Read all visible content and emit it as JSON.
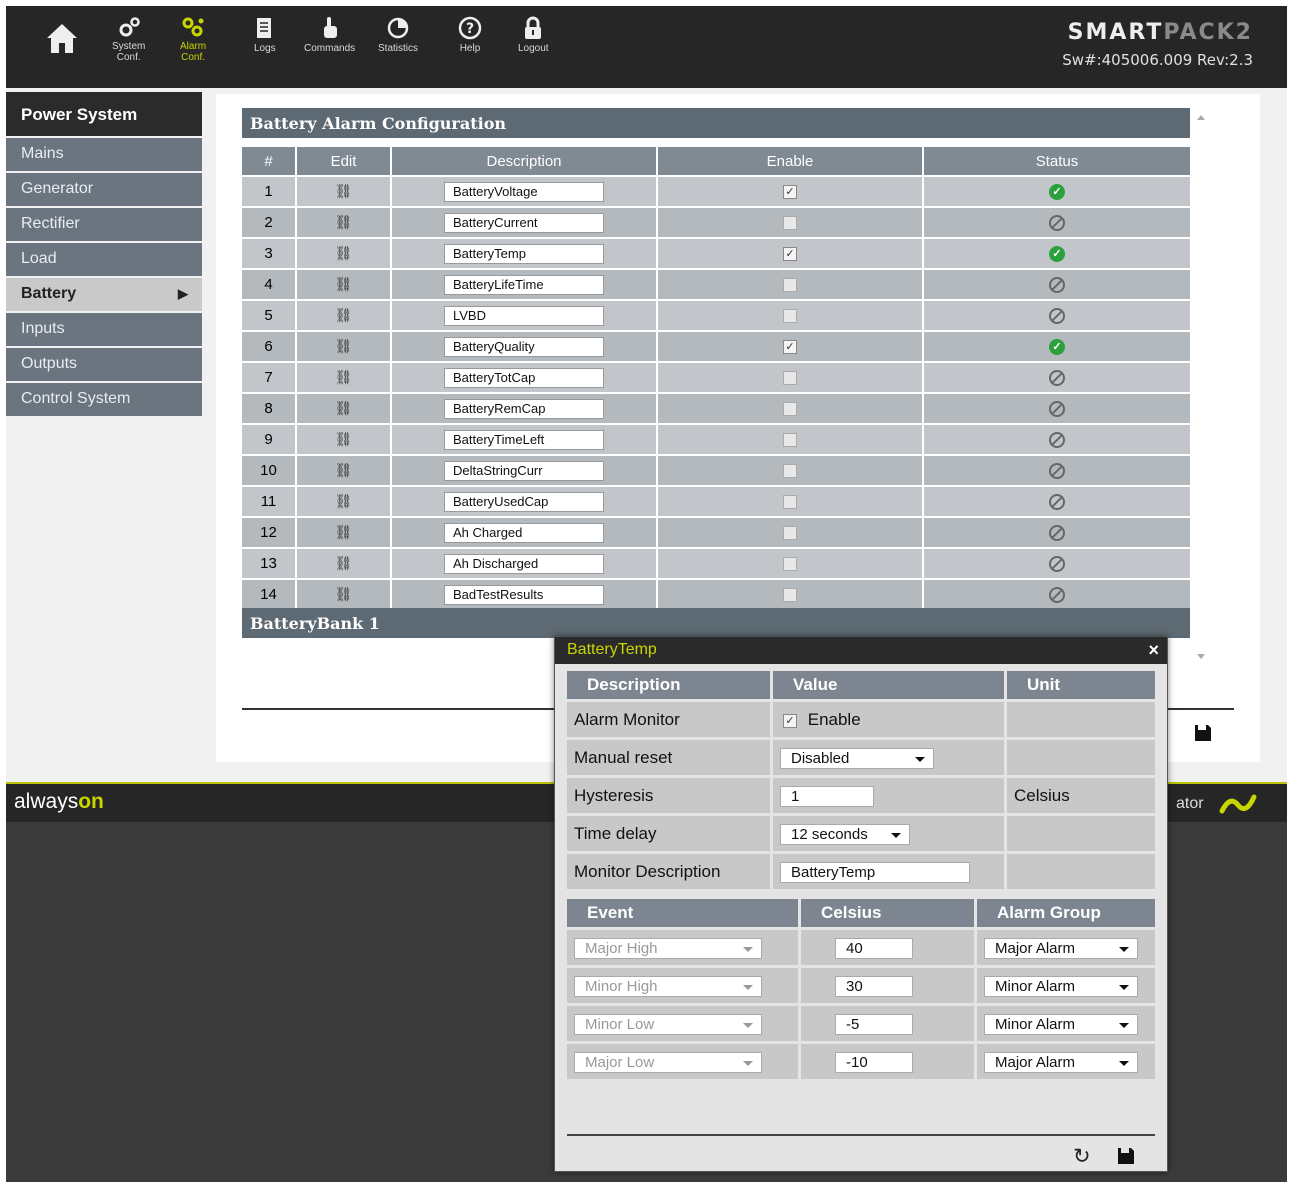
{
  "nav": [
    {
      "label": "",
      "icon": "home-icon"
    },
    {
      "label": "System\nConf.",
      "icon": "gears-icon"
    },
    {
      "label": "Alarm\nConf.",
      "icon": "alarm-gears-icon",
      "active": true
    },
    {
      "label": "Logs",
      "icon": "logs-icon"
    },
    {
      "label": "Commands",
      "icon": "hand-pointer-icon"
    },
    {
      "label": "Statistics",
      "icon": "pie-chart-icon"
    },
    {
      "label": "Help",
      "icon": "help-icon"
    },
    {
      "label": "Logout",
      "icon": "lock-icon"
    }
  ],
  "brand": {
    "logo_a": "SMART",
    "logo_b": "PACK2",
    "sw": "Sw#:405006.009 Rev:2.3"
  },
  "sidebar": {
    "title": "Power System",
    "items": [
      {
        "label": "Mains"
      },
      {
        "label": "Generator"
      },
      {
        "label": "Rectifier"
      },
      {
        "label": "Load"
      },
      {
        "label": "Battery",
        "active": true
      },
      {
        "label": "Inputs"
      },
      {
        "label": "Outputs"
      },
      {
        "label": "Control System"
      }
    ]
  },
  "config": {
    "title": "Battery Alarm Configuration",
    "headers": [
      "#",
      "Edit",
      "Description",
      "Enable",
      "Status"
    ],
    "rows": [
      {
        "n": "1",
        "desc": "BatteryVoltage",
        "enabled": true
      },
      {
        "n": "2",
        "desc": "BatteryCurrent",
        "enabled": false
      },
      {
        "n": "3",
        "desc": "BatteryTemp",
        "enabled": true
      },
      {
        "n": "4",
        "desc": "BatteryLifeTime",
        "enabled": false
      },
      {
        "n": "5",
        "desc": "LVBD",
        "enabled": false
      },
      {
        "n": "6",
        "desc": "BatteryQuality",
        "enabled": true
      },
      {
        "n": "7",
        "desc": "BatteryTotCap",
        "enabled": false
      },
      {
        "n": "8",
        "desc": "BatteryRemCap",
        "enabled": false
      },
      {
        "n": "9",
        "desc": "BatteryTimeLeft",
        "enabled": false
      },
      {
        "n": "10",
        "desc": "DeltaStringCurr",
        "enabled": false
      },
      {
        "n": "11",
        "desc": "BatteryUsedCap",
        "enabled": false
      },
      {
        "n": "12",
        "desc": "Ah Charged",
        "enabled": false
      },
      {
        "n": "13",
        "desc": "Ah Discharged",
        "enabled": false
      },
      {
        "n": "14",
        "desc": "BadTestResults",
        "enabled": false
      }
    ],
    "bank_title": "BatteryBank 1"
  },
  "footer": {
    "logo_a": "always",
    "logo_b": "on",
    "right_text": "ator"
  },
  "dialog": {
    "title": "BatteryTemp",
    "close": "×",
    "headers": [
      "Description",
      "Value",
      "Unit"
    ],
    "alarm_monitor": {
      "label": "Alarm Monitor",
      "value": "Enable",
      "checked": true
    },
    "manual_reset": {
      "label": "Manual reset",
      "value": "Disabled"
    },
    "hysteresis": {
      "label": "Hysteresis",
      "value": "1",
      "unit": "Celsius"
    },
    "time_delay": {
      "label": "Time delay",
      "value": "12 seconds"
    },
    "monitor_desc": {
      "label": "Monitor Description",
      "value": "BatteryTemp"
    },
    "event_headers": [
      "Event",
      "Celsius",
      "Alarm Group"
    ],
    "events": [
      {
        "event": "Major High",
        "value": "40",
        "group": "Major Alarm"
      },
      {
        "event": "Minor High",
        "value": "30",
        "group": "Minor Alarm"
      },
      {
        "event": "Minor Low",
        "value": "-5",
        "group": "Minor Alarm"
      },
      {
        "event": "Major Low",
        "value": "-10",
        "group": "Major Alarm"
      }
    ]
  }
}
